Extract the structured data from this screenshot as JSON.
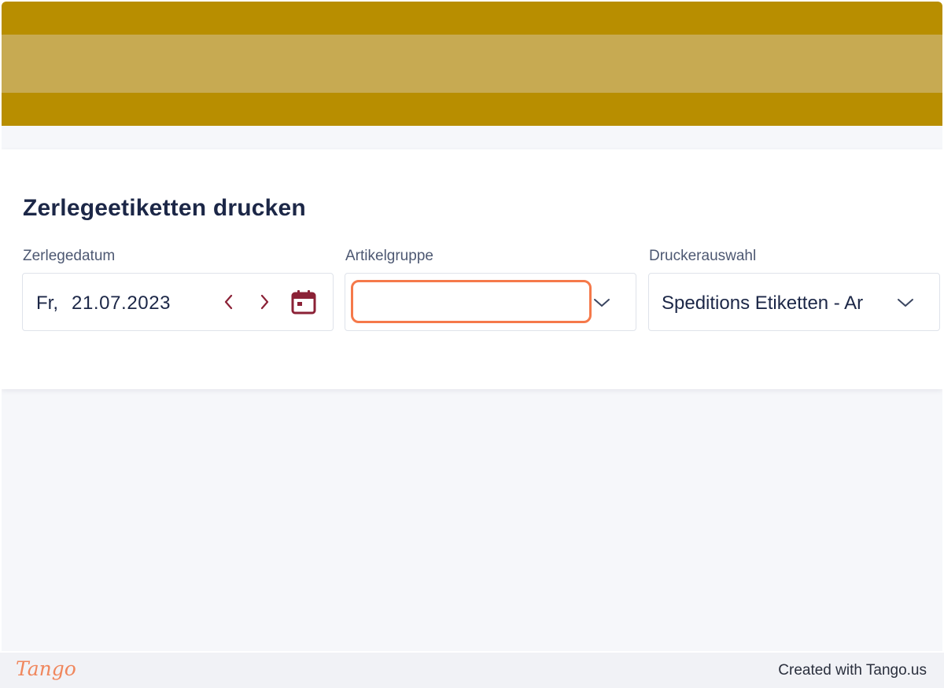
{
  "page": {
    "title": "Zerlegeetiketten drucken"
  },
  "date_field": {
    "label": "Zerlegedatum",
    "weekday": "Fr,",
    "value": "21.07.2023",
    "prev_icon": "chevron-left-icon",
    "next_icon": "chevron-right-icon",
    "calendar_icon": "calendar-icon"
  },
  "article_group": {
    "label": "Artikelgruppe",
    "value": "",
    "dropdown_icon": "chevron-down-icon"
  },
  "printer": {
    "label": "Druckerauswahl",
    "value": "Speditions Etiketten - Ar",
    "dropdown_icon": "chevron-down-icon"
  },
  "footer": {
    "logo": "Tango",
    "credit": "Created with Tango.us"
  },
  "colors": {
    "banner": "#b88e00",
    "banner_stripe": "#c7aa52",
    "accent_icons": "#8b2136",
    "highlight": "#f5794a",
    "title_text": "#1c2747"
  }
}
